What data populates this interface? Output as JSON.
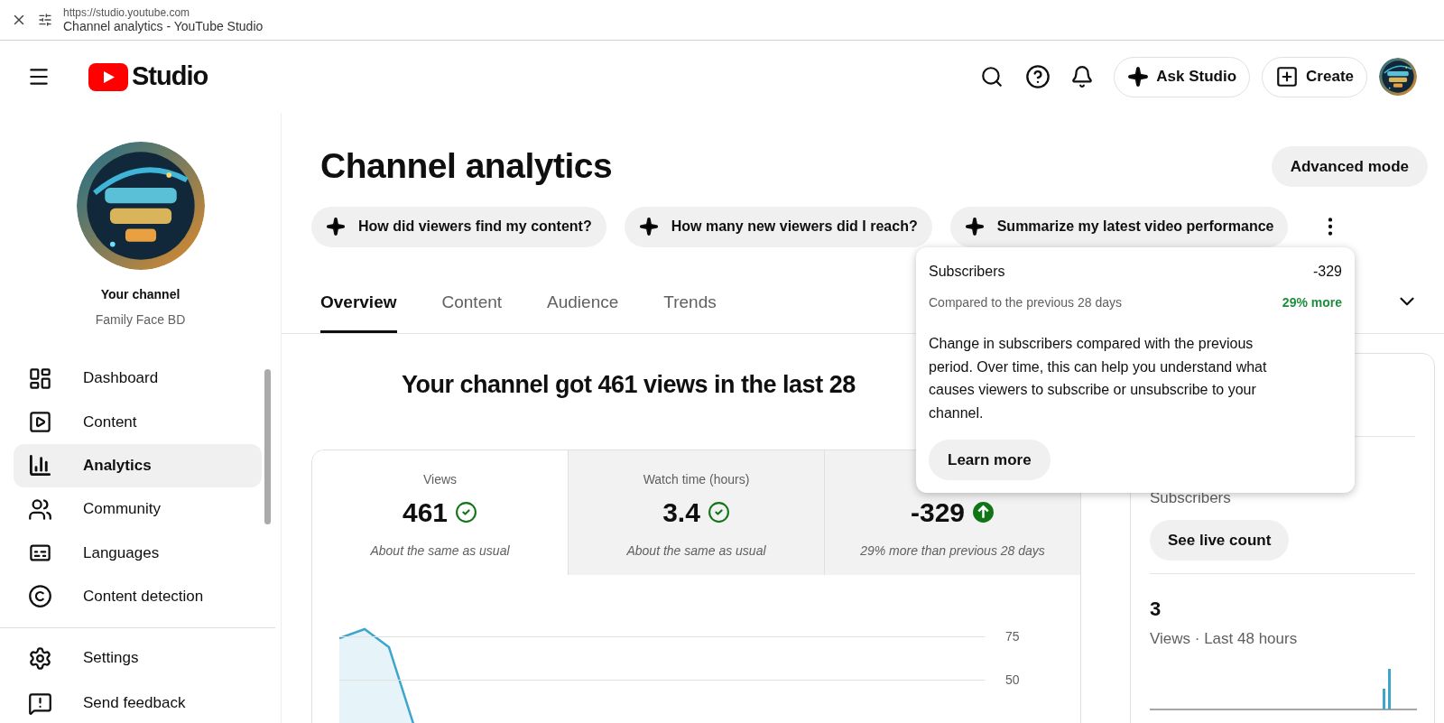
{
  "browser": {
    "url": "https://studio.youtube.com",
    "page_title": "Channel analytics - YouTube Studio"
  },
  "header": {
    "brand": "Studio",
    "actions": [
      {
        "label": "Ask Studio",
        "kind": "ask"
      },
      {
        "label": "Create",
        "kind": "create"
      }
    ]
  },
  "sidebar": {
    "channel_label": "Your channel",
    "channel_name": "Family Face BD",
    "items": [
      {
        "label": "Dashboard",
        "selected": false
      },
      {
        "label": "Content",
        "selected": false
      },
      {
        "label": "Analytics",
        "selected": true
      },
      {
        "label": "Community",
        "selected": false
      },
      {
        "label": "Languages",
        "selected": false
      },
      {
        "label": "Content detection",
        "selected": false
      }
    ],
    "footer_items": [
      {
        "label": "Settings"
      },
      {
        "label": "Send feedback"
      }
    ]
  },
  "page": {
    "title": "Channel analytics",
    "mode_button": "Advanced mode",
    "suggestions": [
      "How did viewers find my content?",
      "How many new viewers did I reach?",
      "Summarize my latest video performance"
    ],
    "tabs": [
      {
        "label": "Overview",
        "selected": true
      },
      {
        "label": "Content",
        "selected": false
      },
      {
        "label": "Audience",
        "selected": false
      },
      {
        "label": "Trends",
        "selected": false
      }
    ],
    "headline": "Your channel got 461 views in the last 28",
    "metrics": [
      {
        "label": "Views",
        "value": "461",
        "kind": "steady",
        "note": "About the same as usual",
        "selected": true
      },
      {
        "label": "Watch time (hours)",
        "value": "3.4",
        "kind": "steady",
        "note": "About the same as usual",
        "selected": false
      },
      {
        "value": "-329",
        "kind": "rising",
        "note": "29% more than previous 28 days",
        "selected": false
      }
    ],
    "chart_ticks": [
      "75",
      "50"
    ]
  },
  "tooltip": {
    "title": "Subscribers",
    "value": "-329",
    "comparison": "Compared to the previous 28 days",
    "change": "29% more",
    "description": "Change in subscribers compared with the previous period. Over time, this can help you understand what causes viewers to subscribe or unsubscribe to your channel.",
    "button": "Learn more"
  },
  "realtime": {
    "subscribers_label": "Subscribers",
    "live_button": "See live count",
    "views": "3",
    "views_caption": "Views · Last 48 hours"
  }
}
